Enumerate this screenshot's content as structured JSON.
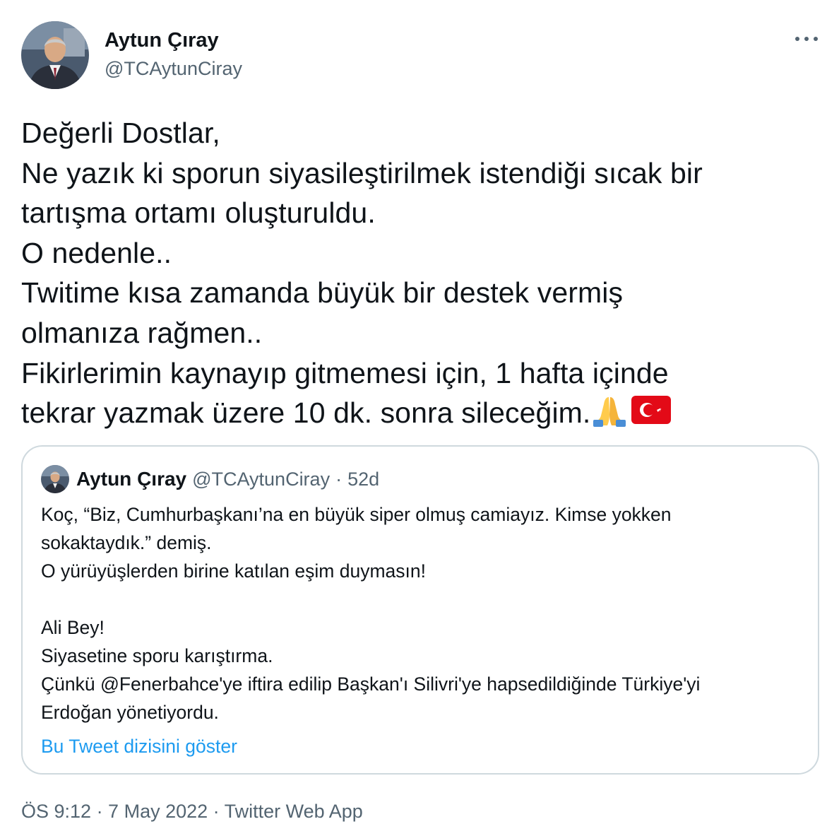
{
  "tweet": {
    "author": {
      "name": "Aytun Çıray",
      "handle": "@TCAytunCiray"
    },
    "more_icon": "more-horizontal-icon",
    "text_lines": [
      "Değerli Dostlar,",
      "Ne yazık ki sporun siyasileştirilmek istendiği sıcak bir",
      "tartışma ortamı oluşturuldu.",
      "O nedenle..",
      "Twitime kısa zamanda büyük bir destek vermiş",
      "olmanıza rağmen..",
      "Fikirlerimin kaynayıp gitmemesi için, 1 hafta içinde",
      "tekrar yazmak üzere 10 dk. sonra sileceğim."
    ],
    "emojis": [
      "folded-hands-emoji",
      "turkey-flag-emoji"
    ],
    "meta": "ÖS 9:12 · 7 May 2022 · Twitter Web App"
  },
  "quoted": {
    "name": "Aytun Çıray",
    "handle": "@TCAytunCiray",
    "separator": "·",
    "time": "52d",
    "text_lines": [
      "Koç, “Biz, Cumhurbaşkanı’na en büyük siper olmuş camiayız. Kimse yokken",
      "sokaktaydık.” demiş.",
      "O yürüyüşlerden birine katılan eşim duymasın!",
      "",
      "Ali Bey!",
      "Siyasetine sporu karıştırma.",
      "Çünkü @Fenerbahce'ye iftira edilip Başkan'ı Silivri'ye hapsedildiğinde Türkiye'yi",
      "Erdoğan yönetiyordu."
    ],
    "show_thread": "Bu Tweet dizisini göster"
  },
  "colors": {
    "link": "#1d9bf0",
    "secondary": "#536471",
    "border": "#cfd9de"
  }
}
